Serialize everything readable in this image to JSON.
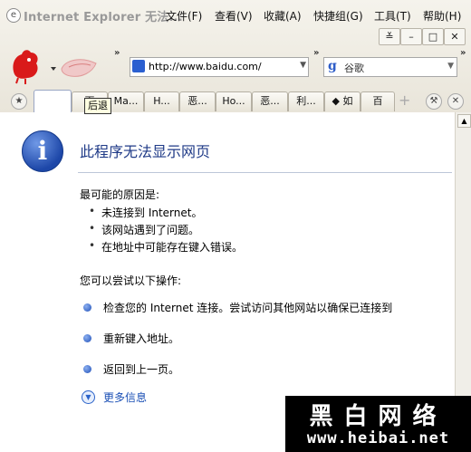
{
  "window": {
    "title": "Internet Explorer 无法...",
    "app_icon": "e",
    "controls": [
      "≚",
      "–",
      "□",
      "✕"
    ]
  },
  "menu": [
    "文件(F)",
    "查看(V)",
    "收藏(A)",
    "快捷组(G)",
    "工具(T)",
    "帮助(H)"
  ],
  "toolbar": {
    "address": "http://www.baidu.com/",
    "search_engine_glyph": "g",
    "search_placeholder": "谷歌",
    "chevron": "»"
  },
  "tabs": [
    {
      "label": ""
    },
    {
      "label": "百"
    },
    {
      "label": "Ma..."
    },
    {
      "label": "H..."
    },
    {
      "label": "恶..."
    },
    {
      "label": "Ho..."
    },
    {
      "label": "恶..."
    },
    {
      "label": "利..."
    },
    {
      "label": "◆ 如"
    },
    {
      "label": "百"
    }
  ],
  "tooltip": "后退",
  "error_page": {
    "headline": "此程序无法显示网页",
    "reasons_title": "最可能的原因是:",
    "reasons": [
      "未连接到 Internet。",
      "该网站遇到了问题。",
      "在地址中可能存在键入错误。"
    ],
    "actions_title": "您可以尝试以下操作:",
    "actions": [
      "检查您的 Internet 连接。尝试访问其他网站以确保已连接到",
      "重新键入地址。",
      "返回到上一页。"
    ],
    "more_info": "更多信息"
  },
  "watermark": {
    "title": "黑白网络",
    "url": "www.heibai.net"
  },
  "colors": {
    "accent": "#1f3a87",
    "link": "#1a4fb5",
    "brand_red": "#d91a1a"
  }
}
